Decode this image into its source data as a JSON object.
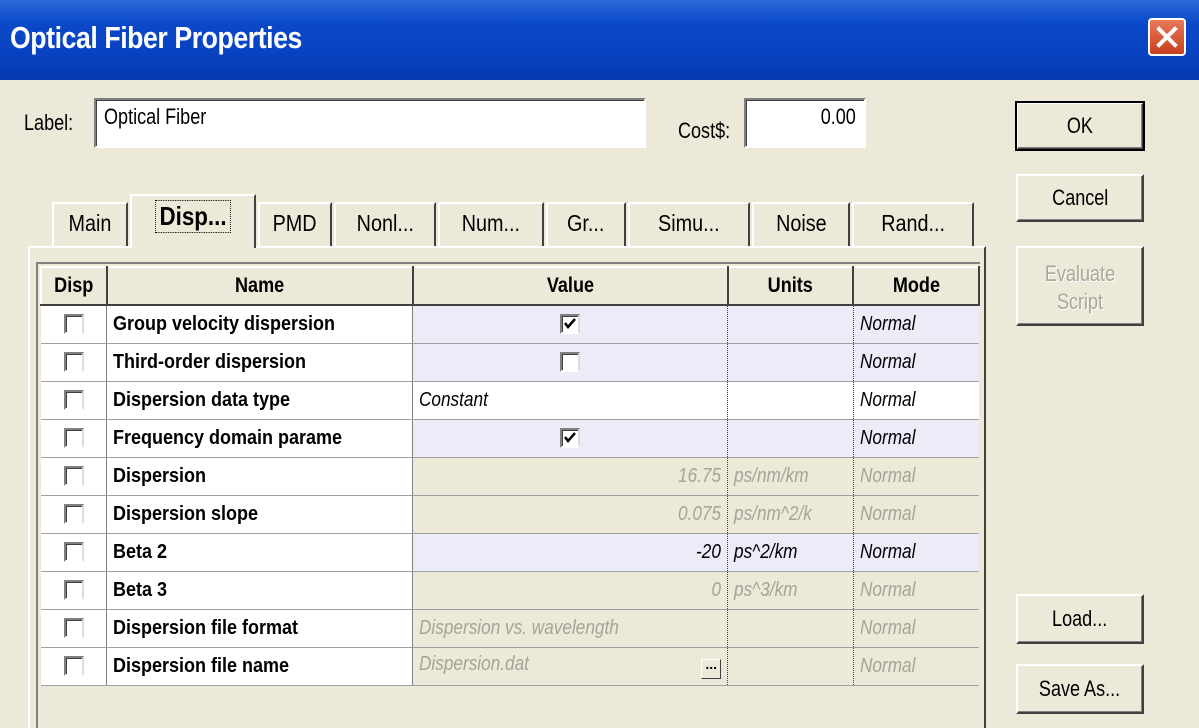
{
  "window": {
    "title": "Optical Fiber Properties"
  },
  "form": {
    "label_caption": "Label:",
    "label_value": "Optical Fiber",
    "cost_caption": "Cost$:",
    "cost_value": "0.00"
  },
  "buttons": {
    "ok": "OK",
    "cancel": "Cancel",
    "evaluate": "Evaluate Script",
    "load": "Load...",
    "save_as": "Save As..."
  },
  "tabs": [
    "Main",
    "Disp...",
    "PMD",
    "Nonl...",
    "Num...",
    "Gr...",
    "Simu...",
    "Noise",
    "Rand..."
  ],
  "table": {
    "headers": [
      "Disp",
      "Name",
      "Value",
      "Units",
      "Mode"
    ],
    "rows": [
      {
        "name": "Group velocity dispersion",
        "value": "",
        "value_checkbox": true,
        "value_checked": true,
        "units": "",
        "mode": "Normal",
        "state": "editable"
      },
      {
        "name": "Third-order dispersion",
        "value": "",
        "value_checkbox": true,
        "value_checked": false,
        "units": "",
        "mode": "Normal",
        "state": "editable"
      },
      {
        "name": "Dispersion data type",
        "value": "Constant",
        "units": "",
        "mode": "Normal",
        "state": "normal"
      },
      {
        "name": "Frequency domain parame",
        "value": "",
        "value_checkbox": true,
        "value_checked": true,
        "units": "",
        "mode": "Normal",
        "state": "editable"
      },
      {
        "name": "Dispersion",
        "value": "16.75",
        "units": "ps/nm/km",
        "mode": "Normal",
        "state": "disabled"
      },
      {
        "name": "Dispersion slope",
        "value": "0.075",
        "units": "ps/nm^2/k",
        "mode": "Normal",
        "state": "disabled"
      },
      {
        "name": "Beta 2",
        "value": "-20",
        "units": "ps^2/km",
        "mode": "Normal",
        "state": "editable"
      },
      {
        "name": "Beta 3",
        "value": "0",
        "units": "ps^3/km",
        "mode": "Normal",
        "state": "disabled"
      },
      {
        "name": "Dispersion file format",
        "value": "Dispersion vs. wavelength",
        "units": "",
        "mode": "Normal",
        "state": "disabled"
      },
      {
        "name": "Dispersion file name",
        "value": "Dispersion.dat",
        "value_button": "...",
        "units": "",
        "mode": "Normal",
        "state": "disabled"
      }
    ]
  }
}
